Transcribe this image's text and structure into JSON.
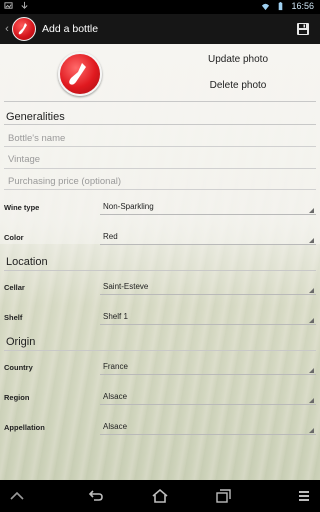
{
  "status_bar": {
    "time": "16:56"
  },
  "action_bar": {
    "title": "Add a bottle"
  },
  "photo": {
    "update_label": "Update photo",
    "delete_label": "Delete photo"
  },
  "generalities": {
    "heading": "Generalities",
    "name_placeholder": "Bottle's name",
    "vintage_placeholder": "Vintage",
    "price_placeholder": "Purchasing price (optional)"
  },
  "wine": {
    "type_label": "Wine type",
    "type_value": "Non-Sparkling",
    "color_label": "Color",
    "color_value": "Red"
  },
  "location": {
    "heading": "Location",
    "cellar_label": "Cellar",
    "cellar_value": "Saint-Esteve",
    "shelf_label": "Shelf",
    "shelf_value": "Shelf 1"
  },
  "origin": {
    "heading": "Origin",
    "country_label": "Country",
    "country_value": "France",
    "region_label": "Region",
    "region_value": "Alsace",
    "appellation_label": "Appellation",
    "appellation_value": "Alsace"
  },
  "icons": [
    "back-icon",
    "app-logo-icon",
    "save-icon",
    "wifi-icon",
    "battery-icon",
    "nav-back-icon",
    "nav-home-icon",
    "nav-recents-icon",
    "nav-menu-icon"
  ]
}
